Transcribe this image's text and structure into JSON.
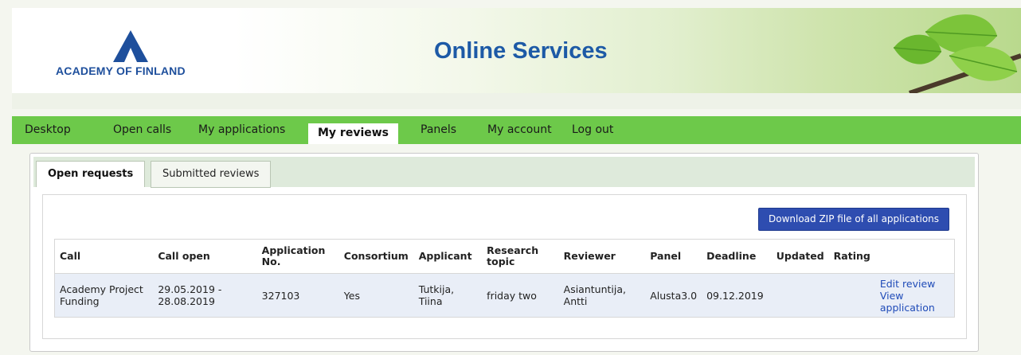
{
  "header": {
    "logo_text": "ACADEMY OF FINLAND",
    "site_title": "Online Services"
  },
  "nav": {
    "items": [
      "Desktop",
      "Open calls",
      "My applications",
      "My reviews",
      "Panels",
      "My account",
      "Log out"
    ],
    "active": "My reviews"
  },
  "tabs": [
    "Open requests",
    "Submitted reviews"
  ],
  "actions": {
    "download_zip": "Download ZIP file of all applications"
  },
  "table": {
    "headers": [
      "Call",
      "Call open",
      "Application No.",
      "Consortium",
      "Applicant",
      "Research topic",
      "Reviewer",
      "Panel",
      "Deadline",
      "Updated",
      "Rating",
      ""
    ],
    "rows": [
      {
        "call": "Academy Project Funding",
        "call_open": "29.05.2019 - 28.08.2019",
        "application_no": "327103",
        "consortium": "Yes",
        "applicant": "Tutkija, Tiina",
        "research_topic": "friday two",
        "reviewer": "Asiantuntija, Antti",
        "panel": "Alusta3.0",
        "deadline": "09.12.2019",
        "updated": "",
        "rating": "",
        "edit_link": "Edit review",
        "view_link": "View application"
      }
    ]
  },
  "colors": {
    "nav_bg": "#6dc94a",
    "title_blue": "#1d5aa6",
    "button_bg": "#2e4db0",
    "row_bg": "#e9eef7",
    "link": "#1f4bb8"
  }
}
